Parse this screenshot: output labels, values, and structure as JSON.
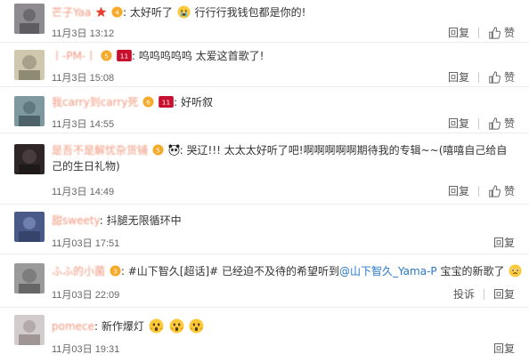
{
  "actions": {
    "reply": "回复",
    "like": "赞",
    "report": "投诉"
  },
  "comments": [
    {
      "username": "芒子Yaa",
      "text": "太好听了",
      "text_after": "行行行我钱包都是你的!",
      "time": "11月3日 13:12",
      "avatar_color": "#7b7b80"
    },
    {
      "username": "丨-PM-丨",
      "text": "呜呜呜呜呜 太爱这首歌了!",
      "time": "11月3日 15:08",
      "avatar_color": "#b7b29a"
    },
    {
      "username": "我carry到carry死",
      "text": "好听叙",
      "time": "11月3日 14:55",
      "avatar_color": "#6f8a92"
    },
    {
      "username": "是吾不是解忧杂货铺",
      "text": "哭辽!!! 太太太好听了吧!啊啊啊啊啊期待我的专辑~~(嘻嘻自己给自己的生日礼物)",
      "time": "11月3日 14:49",
      "avatar_color": "#3a2f2f"
    },
    {
      "username": "甜sweety",
      "text": "抖腿无限循环中",
      "time": "11月03日 17:51",
      "avatar_color": "#4a5a88"
    },
    {
      "username": "ふふ的小菌",
      "text_prefix": "#山下智久[超话]# 已经迫不及待的希望听到",
      "mention": "@山下智久_Yama-P",
      "text_suffix": " 宝宝的新歌了",
      "time": "11月03日 22:09",
      "avatar_color": "#8a8a8a"
    },
    {
      "username": "pomece",
      "text": "新作爆灯",
      "time": "11月03日 19:31",
      "avatar_color": "#c9c2c2"
    }
  ],
  "colors": {
    "username": "#eb7350",
    "mention": "#2878c8",
    "text": "#333333",
    "time": "#666666"
  }
}
